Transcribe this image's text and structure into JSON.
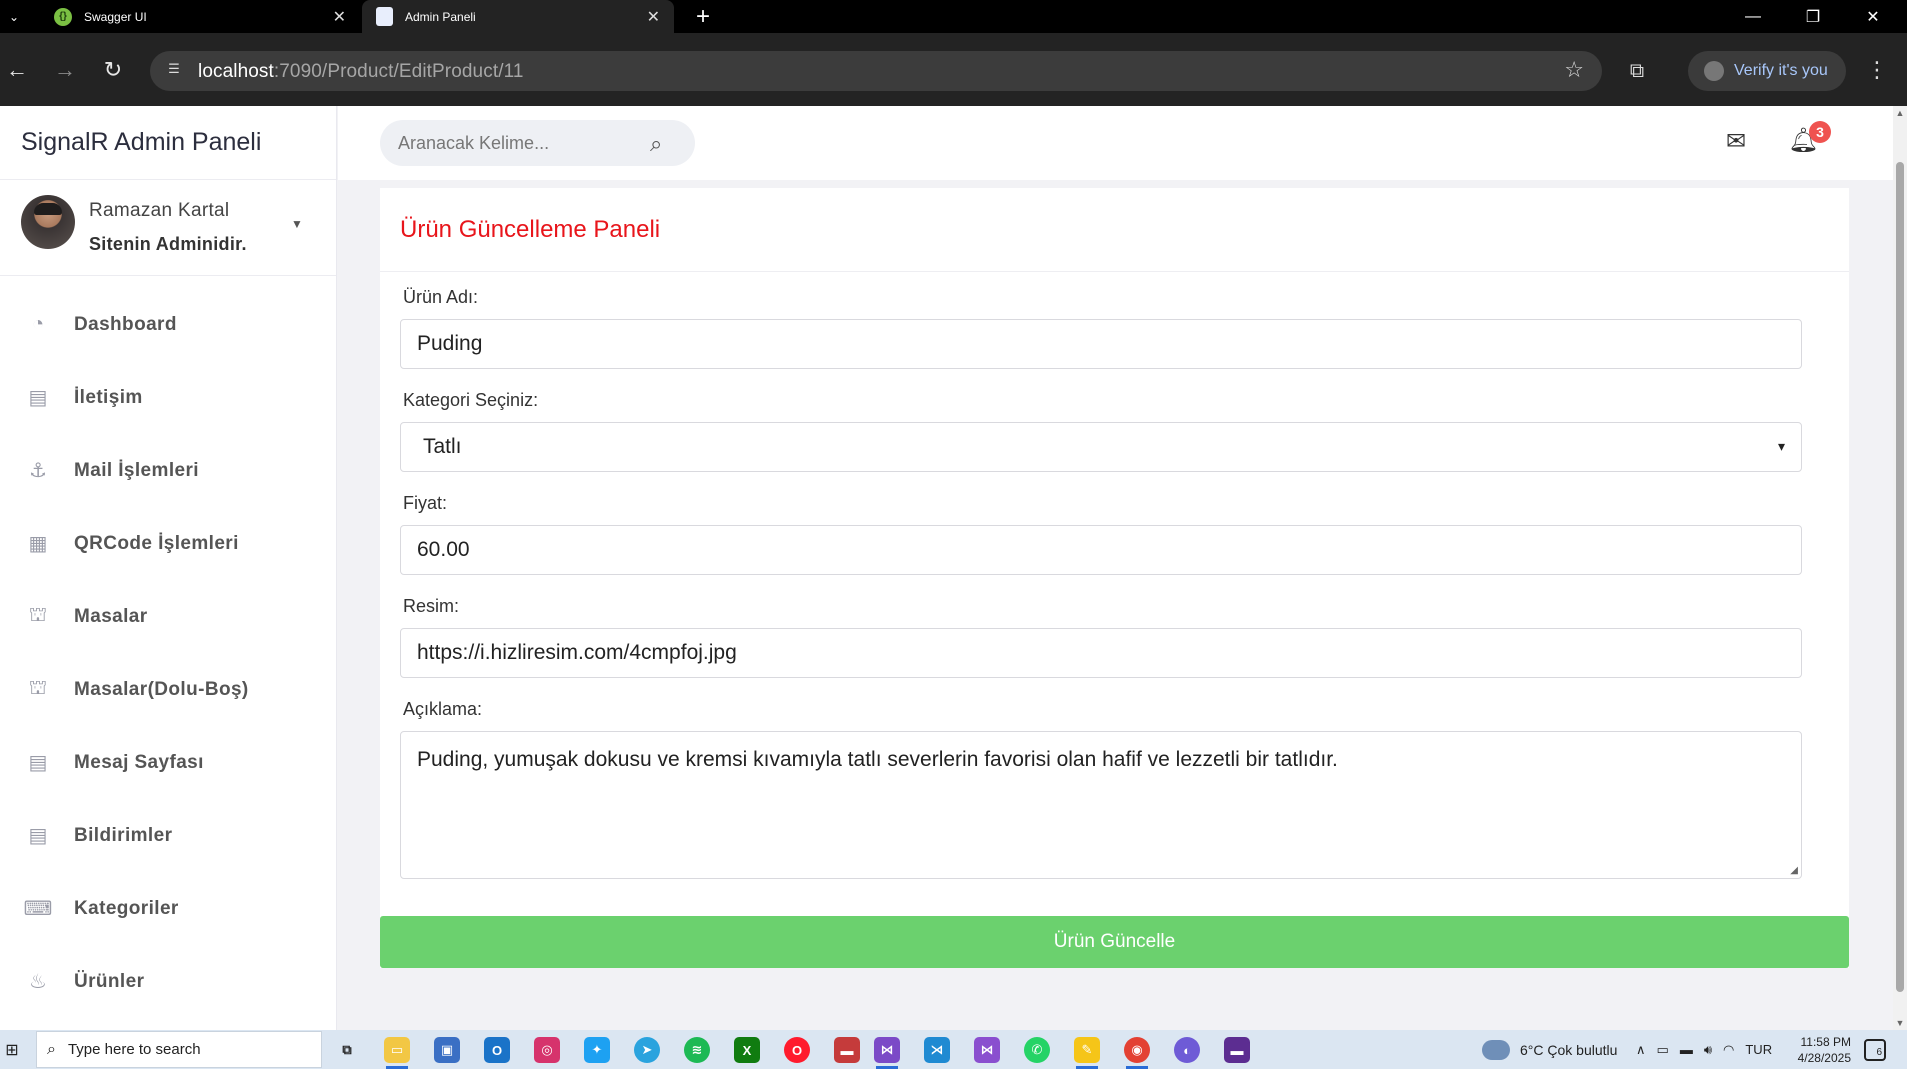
{
  "browser": {
    "tabs": [
      {
        "title": "Swagger UI",
        "favicon": "swagger-icon"
      },
      {
        "title": "Admin Paneli",
        "favicon": "page-icon",
        "active": true
      }
    ],
    "url_host": "localhost",
    "url_rest": ":7090/Product/EditProduct/11",
    "profile_label": "Verify it's you"
  },
  "sidebar": {
    "brand": "SignalR Admin Paneli",
    "user_name": "Ramazan Kartal",
    "user_role": "Sitenin Adminidir.",
    "items": [
      {
        "label": "Dashboard",
        "icon": "gauge-icon"
      },
      {
        "label": "İletişim",
        "icon": "document-icon"
      },
      {
        "label": "Mail İşlemleri",
        "icon": "anchor-icon"
      },
      {
        "label": "QRCode İşlemleri",
        "icon": "qrcode-icon"
      },
      {
        "label": "Masalar",
        "icon": "table-icon"
      },
      {
        "label": "Masalar(Dolu-Boş)",
        "icon": "table-status-icon"
      },
      {
        "label": "Mesaj Sayfası",
        "icon": "document-icon"
      },
      {
        "label": "Bildirimler",
        "icon": "document-icon"
      },
      {
        "label": "Kategoriler",
        "icon": "keyboard-icon"
      },
      {
        "label": "Ürünler",
        "icon": "cake-icon"
      }
    ]
  },
  "topbar": {
    "search_placeholder": "Aranacak Kelime...",
    "notification_count": "3"
  },
  "form": {
    "title": "Ürün Güncelleme Paneli",
    "product_name_label": "Ürün Adı:",
    "product_name": "Puding",
    "category_label": "Kategori Seçiniz:",
    "category": "Tatlı",
    "price_label": "Fiyat:",
    "price": "60.00",
    "image_label": "Resim:",
    "image_url": "https://i.hizliresim.com/4cmpfoj.jpg",
    "description_label": "Açıklama:",
    "description": "Puding, yumuşak dokusu ve kremsi kıvamıyla tatlı severlerin favorisi olan hafif ve lezzetli bir tatlıdır.",
    "submit_label": "Ürün Güncelle"
  },
  "taskbar": {
    "search_placeholder": "Type here to search",
    "weather": "6°C  Çok bulutlu",
    "language": "TUR",
    "time": "11:58 PM",
    "date": "4/28/2025",
    "notifications": "6"
  },
  "colors": {
    "title_red": "#e8151b",
    "button_green": "#6bd16e",
    "badge_red": "#ef5350"
  }
}
